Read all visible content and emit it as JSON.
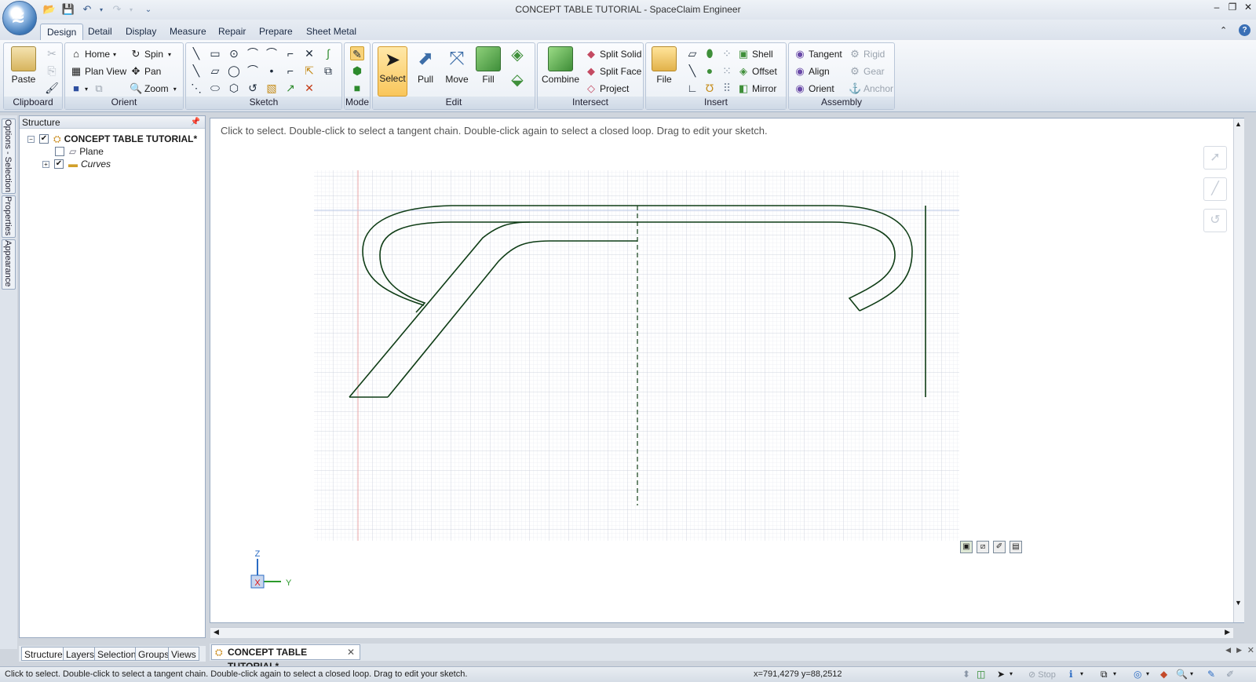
{
  "window": {
    "title": "CONCEPT TABLE TUTORIAL - SpaceClaim Engineer"
  },
  "quick_access": [
    "open-icon",
    "save-icon",
    "undo-icon",
    "redo-icon"
  ],
  "tabs": [
    {
      "label": "Design",
      "active": true
    },
    {
      "label": "Detail"
    },
    {
      "label": "Display"
    },
    {
      "label": "Measure"
    },
    {
      "label": "Repair"
    },
    {
      "label": "Prepare"
    },
    {
      "label": "Sheet Metal"
    }
  ],
  "ribbon": {
    "clipboard": {
      "label": "Clipboard",
      "paste": "Paste"
    },
    "orient": {
      "label": "Orient",
      "home": "Home",
      "plan_view": "Plan View",
      "spin": "Spin",
      "pan": "Pan",
      "zoom": "Zoom"
    },
    "sketch": {
      "label": "Sketch"
    },
    "mode": {
      "label": "Mode"
    },
    "edit": {
      "label": "Edit",
      "select": "Select",
      "pull": "Pull",
      "move": "Move",
      "fill": "Fill"
    },
    "intersect": {
      "label": "Intersect",
      "combine": "Combine",
      "split_solid": "Split Solid",
      "split_face": "Split Face",
      "project": "Project"
    },
    "insert": {
      "label": "Insert",
      "file": "File",
      "shell": "Shell",
      "offset": "Offset",
      "mirror": "Mirror"
    },
    "assembly": {
      "label": "Assembly",
      "tangent": "Tangent",
      "align": "Align",
      "orient": "Orient",
      "rigid": "Rigid",
      "gear": "Gear",
      "anchor": "Anchor"
    }
  },
  "side_tabs": [
    "Options - Selection",
    "Properties",
    "Appearance"
  ],
  "structure": {
    "title": "Structure",
    "root": "CONCEPT TABLE TUTORIAL*",
    "items": [
      {
        "label": "Plane",
        "checked": false
      },
      {
        "label": "Curves",
        "checked": true
      }
    ]
  },
  "panel_tabs": [
    "Structure",
    "Layers",
    "Selection",
    "Groups",
    "Views"
  ],
  "viewport": {
    "hint": "Click to select. Double-click to select a tangent chain. Double-click again to select a closed loop. Drag to edit your sketch.",
    "axis": {
      "z": "Z",
      "y": "Y",
      "x": "X"
    },
    "colors": {
      "curve": "#0f3d16",
      "grid": "#d7dbe4",
      "axis_red": "#e27d7d"
    }
  },
  "doc_tab": "CONCEPT TABLE TUTORIAL*",
  "status": {
    "text": "Click to select. Double-click to select a tangent chain. Double-click again to select a closed loop. Drag to edit your sketch.",
    "coords": "x=791,4279  y=88,2512",
    "stop": "Stop"
  }
}
